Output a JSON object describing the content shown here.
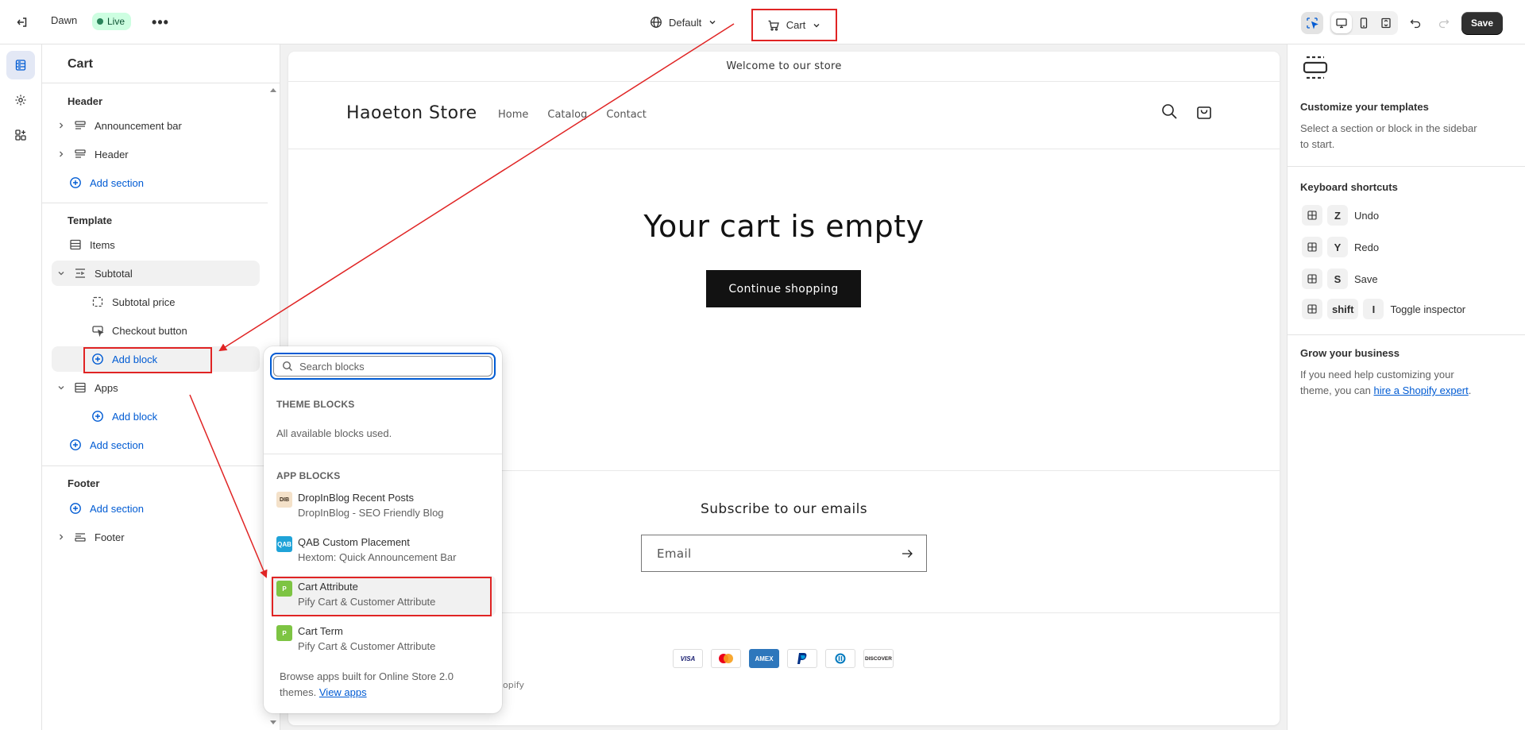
{
  "topbar": {
    "theme_name": "Dawn",
    "live_label": "Live",
    "more_label": "•••",
    "locale_selector": "Default",
    "page_selector": "Cart",
    "save_label": "Save"
  },
  "sidebar": {
    "title": "Cart",
    "header_group": {
      "heading": "Header",
      "items": [
        "Announcement bar",
        "Header"
      ],
      "add_section": "Add section"
    },
    "template_group": {
      "heading": "Template",
      "items_label": "Items",
      "subtotal_label": "Subtotal",
      "subtotal_blocks": [
        "Subtotal price",
        "Checkout button"
      ],
      "add_block": "Add block",
      "apps_label": "Apps",
      "apps_add_block": "Add block",
      "add_section": "Add section"
    },
    "footer_group": {
      "heading": "Footer",
      "add_section": "Add section",
      "footer_label": "Footer"
    }
  },
  "preview": {
    "announcement": "Welcome to our store",
    "store_name": "Haoeton Store",
    "nav": [
      "Home",
      "Catalog",
      "Contact"
    ],
    "empty_title": "Your cart is empty",
    "continue_button": "Continue shopping",
    "subscribe_heading": "Subscribe to our emails",
    "email_placeholder": "Email",
    "payments": [
      "VISA",
      "Mastercard",
      "AMEX",
      "PayPal",
      "Diners",
      "DISCOVER"
    ],
    "powered_by_fragment": "opify"
  },
  "right_panel": {
    "customize_heading": "Customize your templates",
    "customize_text": "Select a section or block in the sidebar to start.",
    "shortcuts_heading": "Keyboard shortcuts",
    "shortcuts": [
      {
        "keys": [
          "Z"
        ],
        "label": "Undo"
      },
      {
        "keys": [
          "Y"
        ],
        "label": "Redo"
      },
      {
        "keys": [
          "S"
        ],
        "label": "Save"
      },
      {
        "keys": [
          "shift",
          "I"
        ],
        "label": "Toggle inspector"
      }
    ],
    "grow_heading": "Grow your business",
    "grow_text_before": "If you need help customizing your theme, you can ",
    "grow_link": "hire a Shopify expert",
    "grow_text_after": "."
  },
  "popover": {
    "search_placeholder": "Search blocks",
    "theme_blocks_heading": "THEME BLOCKS",
    "theme_blocks_message": "All available blocks used.",
    "app_blocks_heading": "APP BLOCKS",
    "app_blocks": [
      {
        "title": "DropInBlog Recent Posts",
        "subtitle": "DropInBlog - SEO Friendly Blog",
        "logo": "DIB",
        "logo_color": "#f4e1c9"
      },
      {
        "title": "QAB Custom Placement",
        "subtitle": "Hextom: Quick Announcement Bar",
        "logo": "QAB",
        "logo_color": "#1fa3d8"
      },
      {
        "title": "Cart Attribute",
        "subtitle": "Pify Cart & Customer Attribute",
        "logo": "P",
        "logo_color": "#7dc443"
      },
      {
        "title": "Cart Term",
        "subtitle": "Pify Cart & Customer Attribute",
        "logo": "P",
        "logo_color": "#7dc443"
      }
    ],
    "footer_text": "Browse apps built for Online Store 2.0 themes.",
    "footer_link": "View apps"
  },
  "colors": {
    "accent_blue": "#005bd3",
    "annotation_red": "#e02424",
    "live_green": "#29845a"
  }
}
